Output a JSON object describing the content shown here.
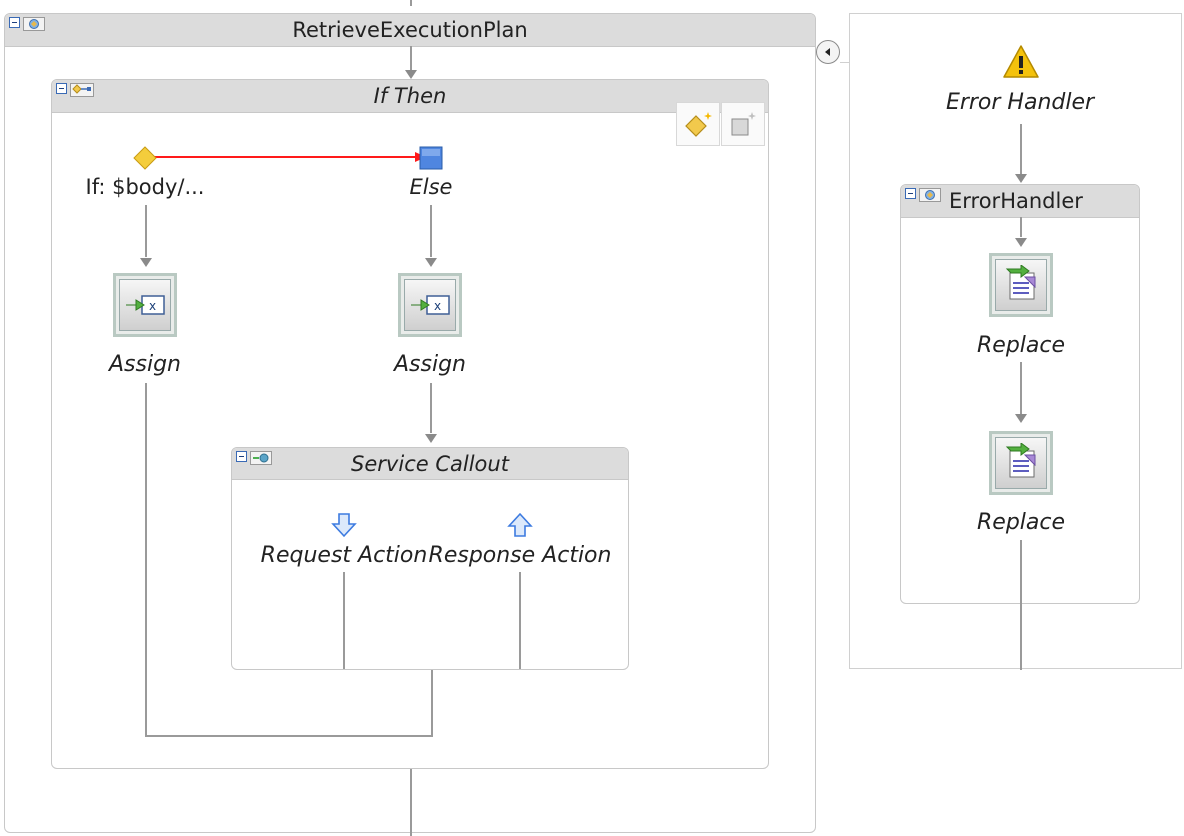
{
  "main_scope": {
    "title": "RetrieveExecutionPlan"
  },
  "if_then": {
    "title": "If Then",
    "branches": [
      {
        "label": "If: $body/...",
        "action": "Assign"
      },
      {
        "label": "Else",
        "action": "Assign"
      }
    ]
  },
  "service_callout": {
    "title": "Service Callout",
    "request_label": "Request Action",
    "response_label": "Response Action"
  },
  "error_panel": {
    "title": "Error Handler",
    "scope_title": "ErrorHandler",
    "actions": [
      "Replace",
      "Replace"
    ]
  },
  "colors": {
    "branch_connector": "#ff1a1a",
    "header": "#dcdcdc",
    "callout_arrow": "#3d7be0"
  }
}
